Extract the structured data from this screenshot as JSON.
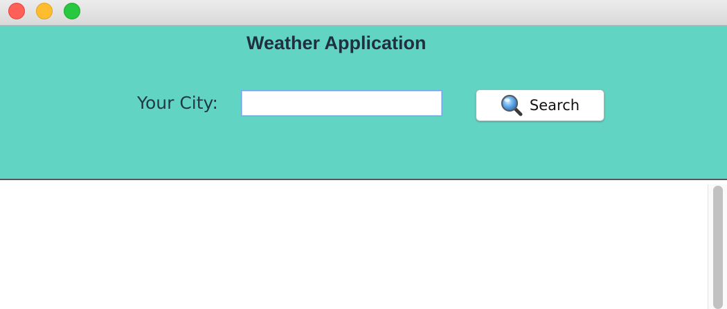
{
  "window": {
    "controls": {
      "close": "close-button",
      "minimize": "minimize-button",
      "zoom": "zoom-button"
    }
  },
  "header": {
    "title": "Weather Application",
    "background_color": "#62d4c4"
  },
  "search": {
    "label": "Your City:",
    "value": "",
    "button_label": "Search",
    "button_icon": "magnifier-icon"
  },
  "results": {
    "content": ""
  }
}
